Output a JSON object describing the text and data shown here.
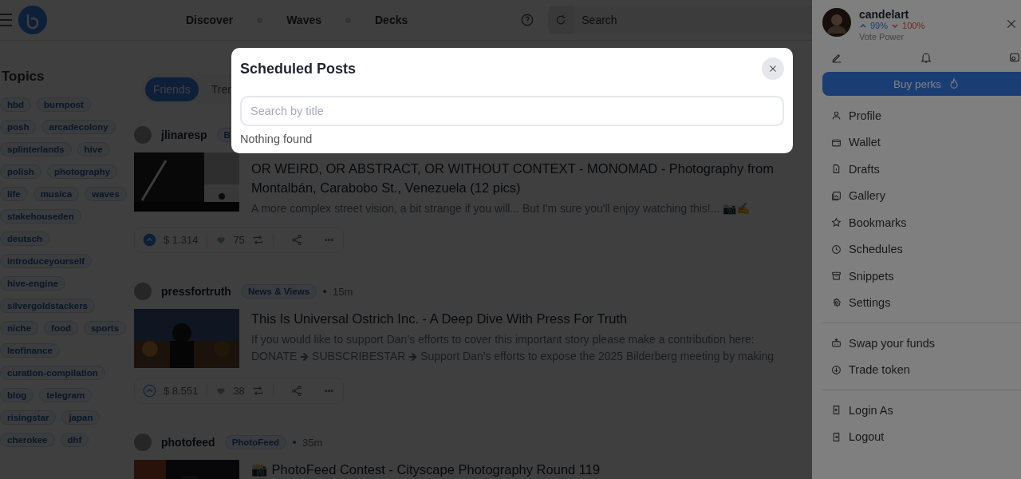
{
  "header": {
    "nav": [
      "Discover",
      "Waves",
      "Decks"
    ],
    "search": {
      "placeholder": "Search"
    }
  },
  "topics": {
    "title": "Topics",
    "rows": [
      [
        "hbd",
        "burnpost"
      ],
      [
        "posh",
        "arcadecolony"
      ],
      [
        "splinterlands",
        "hive"
      ],
      [
        "polish",
        "photography"
      ],
      [
        "life",
        "musica",
        "waves"
      ],
      [
        "stakehouseden"
      ],
      [
        "deutsch"
      ],
      [
        "introduceyourself"
      ],
      [
        "hive-engine"
      ],
      [
        "silvergoldstackers"
      ],
      [
        "niche",
        "food",
        "sports"
      ],
      [
        "leofinance"
      ],
      [
        "curation-compilation"
      ],
      [
        "blog",
        "telegram"
      ],
      [
        "risingstar",
        "japan"
      ],
      [
        "cherokee",
        "dhf"
      ]
    ]
  },
  "feed": {
    "tabs": [
      {
        "label": "Friends",
        "selected": true
      },
      {
        "label": "Tren",
        "selected": false
      }
    ],
    "posts": [
      {
        "author": "jlinaresp",
        "community": "B",
        "title": "OR WEIRD, OR ABSTRACT, OR WITHOUT CONTEXT - MONOMAD - Photography from Montalbán, Carabobo St., Venezuela (12 pics)",
        "excerpt": "A more complex street vision, a bit strange if you will... But I'm sure you'll enjoy watching this!... 📷✍️",
        "payout": "$ 1.314",
        "votes": "75",
        "upvoted": true
      },
      {
        "author": "pressfortruth",
        "community": "News & Views",
        "time": "15m",
        "title": "This Is Universal Ostrich Inc. - A Deep Dive With Press For Truth",
        "excerpt": "If you would like to support Dan’s efforts to cover this important story please make a contribution here: DONATE 🡺 SUBSCRIBESTAR 🡺 Support Dan’s efforts to expose the 2025 Bilderberg meeting by making",
        "payout": "$ 8.551",
        "votes": "38",
        "upvoted": false
      },
      {
        "author": "photofeed",
        "community": "PhotoFeed",
        "time": "35m",
        "title": "📸 PhotoFeed Contest - Cityscape Photography Round 119"
      }
    ]
  },
  "drawer": {
    "user": {
      "name": "candelart",
      "up": "99%",
      "down": "100%",
      "caption": "Vote Power"
    },
    "buy": "Buy perks",
    "groups": [
      [
        "Profile",
        "Wallet",
        "Drafts",
        "Gallery",
        "Bookmarks",
        "Schedules",
        "Snippets",
        "Settings"
      ],
      [
        "Swap your funds",
        "Trade token"
      ],
      [
        "Login As",
        "Logout"
      ]
    ]
  },
  "modal": {
    "title": "Scheduled Posts",
    "search": {
      "placeholder": "Search by title"
    },
    "empty": "Nothing found"
  }
}
